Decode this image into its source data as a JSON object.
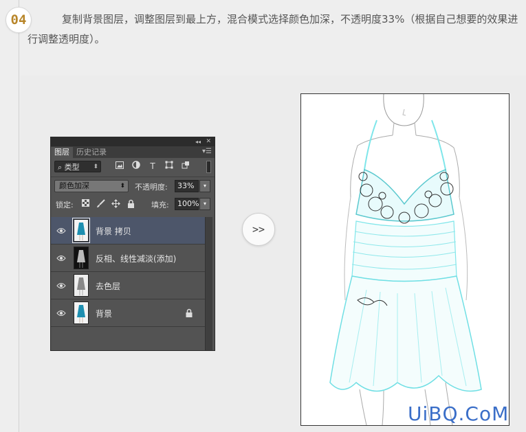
{
  "step": {
    "number": "04",
    "description": "复制背景图层，调整图层到最上方，混合模式选择颜色加深，不透明度33%（根据自己想要的效果进行调整透明度）。"
  },
  "panel": {
    "tabs": [
      {
        "label": "图层",
        "active": true
      },
      {
        "label": "历史记录",
        "active": false
      }
    ],
    "collapse_glyph": "◂◂",
    "close_glyph": "✕",
    "menu_glyph": "▾☰",
    "filter": {
      "kind_label": "类型",
      "search_glyph": "⌕",
      "type_glyph": "T"
    },
    "blend_mode": "颜色加深",
    "opacity_label": "不透明度:",
    "opacity": "33%",
    "lock_label": "锁定:",
    "fill_label": "填充:",
    "fill": "100%",
    "layers": [
      {
        "name": "背景 拷贝",
        "selected": true,
        "thumb": "teal",
        "locked": false
      },
      {
        "name": "反相、线性减淡(添加)",
        "selected": false,
        "thumb": "dark",
        "locked": false
      },
      {
        "name": "去色层",
        "selected": false,
        "thumb": "gray",
        "locked": false
      },
      {
        "name": "背景",
        "selected": false,
        "thumb": "teal",
        "locked": true
      }
    ]
  },
  "next_label": ">>",
  "watermark": "UiBQ.CoM",
  "colors": {
    "selected_layer": "#4d566a",
    "panel_bg": "#535353",
    "dress_line": "#7fe6ea",
    "watermark": "#3a6ec8"
  }
}
